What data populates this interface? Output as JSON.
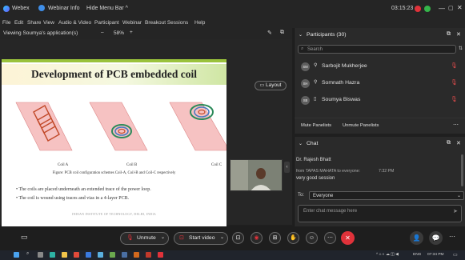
{
  "topbar": {
    "app_name": "Webex",
    "webinar_info": "Webinar Info",
    "hide_menu": "Hide Menu Bar ^",
    "timer": "03:15:23"
  },
  "menu": [
    "File",
    "Edit",
    "Share",
    "View",
    "Audio & Video",
    "Participant",
    "Webinar",
    "Breakout Sessions",
    "Help"
  ],
  "viewbar": {
    "label": "Viewing Soumya's application(s)",
    "minus": "–",
    "zoom": "58%",
    "plus": "+"
  },
  "stage": {
    "layout_label": "Layout"
  },
  "slide": {
    "title": "Development of PCB embedded coil",
    "coil_labels": [
      "Coil A",
      "Coil B",
      "Coil C"
    ],
    "caption": "Figure: PCB coil configuration schemes Coil-A, Coil-B and Coil-C respectively",
    "bullets": [
      "• The coils are placed underneath an extended trace of the power loop.",
      "• The coil is wound using traces and vias in a 4-layer PCB."
    ],
    "footer": "INDIAN INSTITUTE OF TECHNOLOGY, DELHI, INDIA"
  },
  "participants": {
    "header": "Participants (30)",
    "search_placeholder": "Search",
    "list": [
      {
        "initials": "SM",
        "name": "Sarbojit Mukherjee"
      },
      {
        "initials": "SH",
        "name": "Somnath Hazra"
      },
      {
        "initials": "SB",
        "name": "Soumya Biswas"
      }
    ],
    "mute_panelists": "Mute Panelists",
    "unmute_panelists": "Unmute Panelists"
  },
  "chat": {
    "header": "Chat",
    "sender": "Dr. Rajesh Bhatt",
    "meta": "from TAPAS MAHATA to everyone:",
    "time": "7:32 PM",
    "message": "very good session",
    "to_label": "To:",
    "to_value": "Everyone",
    "input_placeholder": "Enter chat message here"
  },
  "controls": {
    "unmute": "Unmute",
    "start_video": "Start video"
  },
  "taskbar": {
    "lang": "ENG",
    "time": "07:34 PM"
  },
  "colors": {
    "end_button": "#e0323a",
    "slide_accent": "#9ac23c",
    "muted_red": "#d94a4a"
  }
}
